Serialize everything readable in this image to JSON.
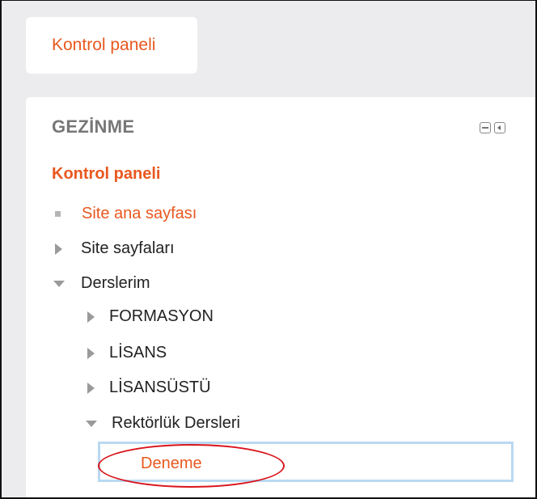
{
  "breadcrumb": {
    "label": "Kontrol paneli"
  },
  "navigation_block": {
    "title": "GEZİNME",
    "controls": {
      "minimize_icon": "minus-box-icon",
      "dock_icon": "dock-left-icon"
    },
    "root": "Kontrol paneli",
    "items": [
      {
        "label": "Site ana sayfası",
        "icon": "bullet-icon",
        "link": true
      },
      {
        "label": "Site sayfaları",
        "icon": "collapsed-arrow-icon",
        "link": false
      },
      {
        "label": "Derslerim",
        "icon": "expanded-arrow-icon",
        "link": false
      },
      {
        "label": "FORMASYON",
        "icon": "collapsed-arrow-icon",
        "link": false
      },
      {
        "label": "LİSANS",
        "icon": "collapsed-arrow-icon",
        "link": false
      },
      {
        "label": "LİSANSÜSTÜ",
        "icon": "collapsed-arrow-icon",
        "link": false
      },
      {
        "label": "Rektörlük Dersleri",
        "icon": "expanded-arrow-icon",
        "link": false
      }
    ],
    "active_item": {
      "label": "Deneme"
    }
  },
  "colors": {
    "link": "#e8581f",
    "active_border": "#b9d9f2",
    "annotation_circle": "#d9141b",
    "page_background": "#ececef"
  }
}
